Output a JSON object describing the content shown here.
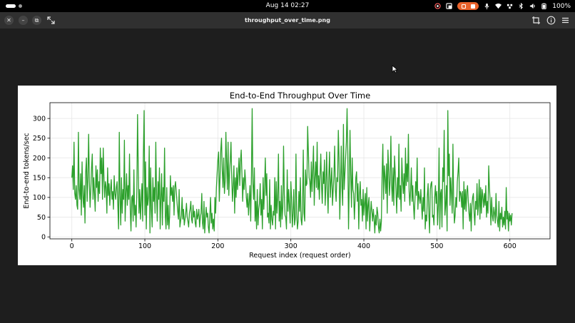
{
  "topbar": {
    "clock": "Aug 14  02:27",
    "battery": "100%"
  },
  "window": {
    "title": "throughput_over_time.png"
  },
  "chart_data": {
    "type": "line",
    "title": "End-to-End Throughput Over Time",
    "xlabel": "Request index (request order)",
    "ylabel": "End-to-end tokens/sec",
    "xlim": [
      -30,
      655
    ],
    "ylim": [
      -5,
      340
    ],
    "xticks": [
      0,
      100,
      200,
      300,
      400,
      500,
      600
    ],
    "yticks": [
      0,
      50,
      100,
      150,
      200,
      250,
      300
    ],
    "grid": true,
    "color": "#2ca02c",
    "series": [
      {
        "x_start": 0,
        "x_step": 1,
        "values": [
          150,
          180,
          120,
          240,
          110,
          95,
          130,
          80,
          70,
          265,
          120,
          95,
          160,
          55,
          190,
          105,
          75,
          130,
          35,
          165,
          200,
          90,
          150,
          260,
          140,
          75,
          120,
          175,
          210,
          95,
          150,
          110,
          65,
          180,
          125,
          170,
          90,
          140,
          110,
          225,
          160,
          200,
          95,
          225,
          150,
          100,
          140,
          125,
          60,
          175,
          105,
          135,
          80,
          120,
          145,
          95,
          115,
          70,
          155,
          110,
          95,
          125,
          140,
          80,
          20,
          265,
          105,
          30,
          150,
          60,
          120,
          95,
          245,
          40,
          110,
          160,
          80,
          130,
          95,
          210,
          70,
          15,
          100,
          105,
          40,
          170,
          55,
          80,
          25,
          115,
          310,
          170,
          60,
          120,
          45,
          90,
          135,
          40,
          210,
          320,
          55,
          190,
          20,
          125,
          80,
          100,
          230,
          10,
          175,
          70,
          25,
          150,
          90,
          125,
          60,
          240,
          110,
          40,
          140,
          95,
          175,
          20,
          100,
          160,
          30,
          125,
          90,
          225,
          55,
          20,
          125,
          30,
          80,
          20,
          55,
          155,
          105,
          125,
          90,
          130,
          55,
          125,
          140,
          115,
          90,
          65,
          45,
          120,
          25,
          40,
          55,
          100,
          45,
          70,
          30,
          45,
          60,
          85,
          50,
          40,
          25,
          60,
          70,
          90,
          45,
          35,
          80,
          50,
          65,
          35,
          25,
          70,
          45,
          55,
          70,
          25,
          50,
          60,
          110,
          35,
          20,
          90,
          10,
          45,
          75,
          50,
          60,
          25,
          10,
          55,
          100,
          35,
          60,
          20,
          45,
          15,
          100,
          60,
          125,
          160,
          195,
          215,
          90,
          150,
          220,
          250,
          170,
          125,
          200,
          110,
          140,
          265,
          190,
          120,
          240,
          105,
          160,
          195,
          240,
          150,
          90,
          130,
          180,
          60,
          150,
          100,
          175,
          120,
          160,
          200,
          130,
          190,
          220,
          160,
          90,
          150,
          120,
          170,
          140,
          100,
          75,
          110,
          55,
          90,
          130,
          40,
          155,
          325,
          135,
          95,
          175,
          40,
          90,
          20,
          120,
          30,
          70,
          85,
          135,
          55,
          95,
          20,
          150,
          70,
          125,
          200,
          105,
          160,
          50,
          60,
          35,
          145,
          20,
          80,
          45,
          30,
          65,
          55,
          150,
          20,
          140,
          60,
          100,
          210,
          40,
          90,
          25,
          130,
          45,
          75,
          230,
          110,
          55,
          50,
          20,
          170,
          65,
          120,
          80,
          35,
          140,
          95,
          25,
          60,
          120,
          30,
          45,
          210,
          60,
          20,
          40,
          115,
          65,
          150,
          45,
          30,
          70,
          220,
          60,
          40,
          170,
          130,
          135,
          280,
          215,
          150,
          140,
          100,
          190,
          115,
          170,
          230,
          80,
          150,
          190,
          125,
          240,
          120,
          155,
          95,
          160,
          210,
          130,
          85,
          165,
          135,
          195,
          80,
          130,
          215,
          120,
          60,
          155,
          215,
          100,
          140,
          175,
          80,
          120,
          155,
          230,
          120,
          90,
          150,
          140,
          270,
          200,
          45,
          130,
          230,
          125,
          80,
          285,
          120,
          160,
          200,
          240,
          325,
          210,
          20,
          135,
          270,
          160,
          75,
          200,
          120,
          110,
          45,
          95,
          150,
          165,
          90,
          135,
          20,
          105,
          140,
          80,
          95,
          40,
          120,
          55,
          85,
          110,
          20,
          125,
          40,
          80,
          100,
          15,
          55,
          90,
          65,
          40,
          70,
          45,
          10,
          55,
          30,
          75,
          60,
          25,
          10,
          45,
          15,
          40,
          160,
          235,
          95,
          180,
          150,
          110,
          185,
          60,
          220,
          170,
          105,
          145,
          255,
          130,
          90,
          175,
          80,
          205,
          160,
          115,
          60,
          150,
          100,
          235,
          95,
          130,
          65,
          200,
          145,
          110,
          160,
          90,
          225,
          130,
          185,
          140,
          260,
          115,
          80,
          120,
          175,
          90,
          130,
          80,
          45,
          95,
          140,
          105,
          200,
          70,
          115,
          100,
          85,
          120,
          80,
          45,
          100,
          65,
          175,
          20,
          55,
          40,
          105,
          135,
          60,
          10,
          120,
          135,
          140,
          50,
          55,
          30,
          100,
          130,
          85,
          115,
          30,
          80,
          225,
          20,
          110,
          120,
          25,
          175,
          140,
          270,
          55,
          80,
          130,
          15,
          320,
          155,
          210,
          80,
          150,
          110,
          60,
          235,
          90,
          35,
          55,
          100,
          75,
          140,
          165,
          200,
          90,
          115,
          110,
          75,
          115,
          20,
          140,
          70,
          120,
          65,
          115,
          130,
          90,
          60,
          40,
          85,
          15,
          80,
          100,
          110,
          60,
          30,
          90,
          70,
          135,
          55,
          80,
          145,
          45,
          125,
          60,
          120,
          100,
          75,
          110,
          80,
          130,
          50,
          90,
          60,
          180,
          125,
          90,
          30,
          100,
          55,
          40,
          75,
          60,
          35,
          110,
          55,
          40,
          25,
          90,
          15,
          60,
          45,
          75,
          25,
          50,
          30,
          65,
          20,
          125,
          45,
          65,
          15,
          60,
          40,
          55,
          30,
          60
        ]
      }
    ]
  }
}
